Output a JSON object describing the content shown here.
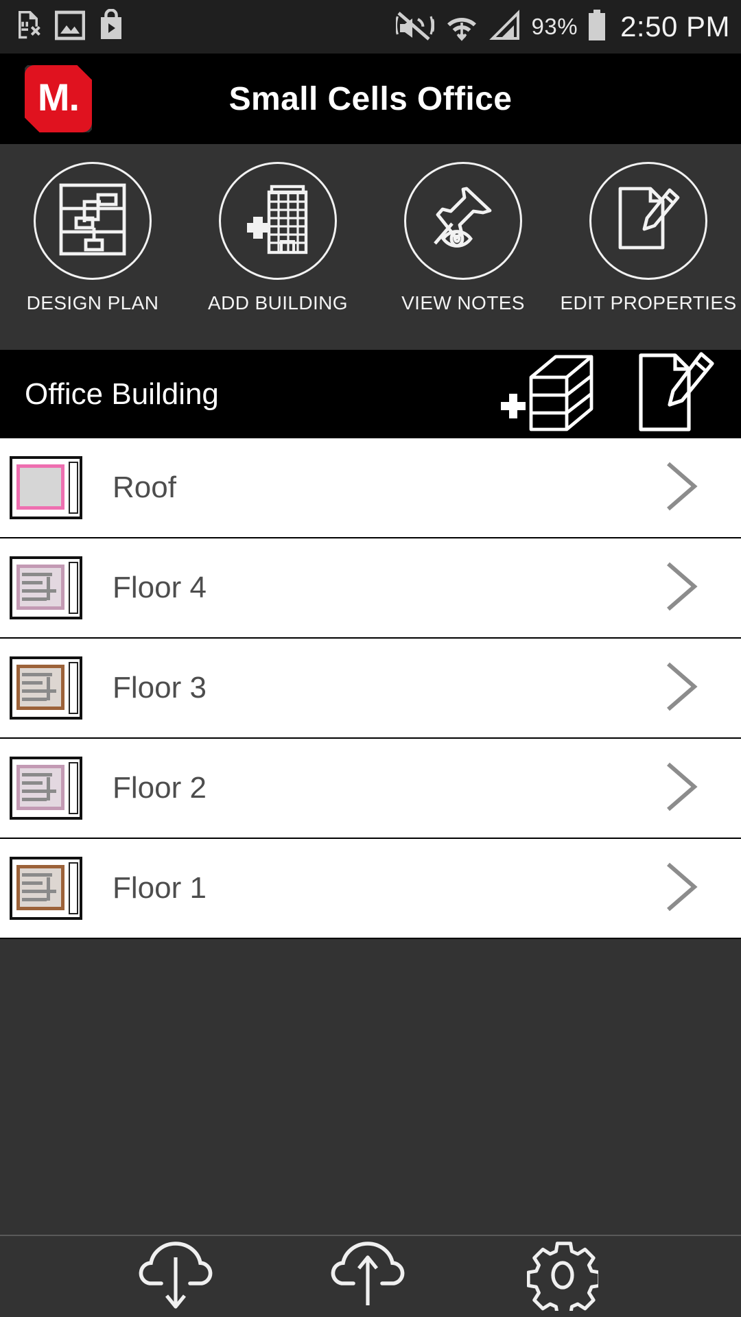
{
  "status_bar": {
    "left_icons": [
      "sim-card-off-icon",
      "gallery-image-icon",
      "play-store-bag-icon"
    ],
    "right_icons": [
      "vibrate-mute-icon",
      "wifi-icon",
      "cellular-signal-icon",
      "battery-icon"
    ],
    "battery_percent": "93%",
    "time": "2:50 PM"
  },
  "app_bar": {
    "logo_text": "M.",
    "logo_color": "#e0121f",
    "title": "Small Cells Office"
  },
  "actions": [
    {
      "label": "DESIGN PLAN",
      "icon": "design-plan-icon"
    },
    {
      "label": "ADD BUILDING",
      "icon": "add-building-icon"
    },
    {
      "label": "VIEW NOTES",
      "icon": "view-notes-pin-eye-icon"
    },
    {
      "label": "EDIT PROPERTIES",
      "icon": "edit-properties-document-pencil-icon"
    }
  ],
  "section": {
    "title": "Office Building",
    "add_floor_icon": "add-floor-cube-icon",
    "edit_building_icon": "edit-building-document-pencil-icon"
  },
  "floors": [
    {
      "label": "Roof",
      "thumbnail_outline_color": "#ee6fb0",
      "chevron": "chevron-right-icon",
      "detailed": false
    },
    {
      "label": "Floor 4",
      "thumbnail_outline_color": "#c39ab4",
      "chevron": "chevron-right-icon",
      "detailed": true
    },
    {
      "label": "Floor 3",
      "thumbnail_outline_color": "#9c6239",
      "chevron": "chevron-right-icon",
      "detailed": true
    },
    {
      "label": "Floor 2",
      "thumbnail_outline_color": "#c39ab4",
      "chevron": "chevron-right-icon",
      "detailed": true
    },
    {
      "label": "Floor 1",
      "thumbnail_outline_color": "#9c6239",
      "chevron": "chevron-right-icon",
      "detailed": true
    }
  ],
  "bottom_bar": [
    {
      "icon": "cloud-download-icon"
    },
    {
      "icon": "cloud-upload-icon"
    },
    {
      "icon": "settings-gear-icon"
    }
  ],
  "colors": {
    "app_bar_bg": "#000000",
    "toolbar_bg": "#333333",
    "status_bar_bg": "#1f1f1f",
    "list_bg": "#ffffff",
    "list_text": "#4d4d4d",
    "accent_red": "#e0121f"
  }
}
